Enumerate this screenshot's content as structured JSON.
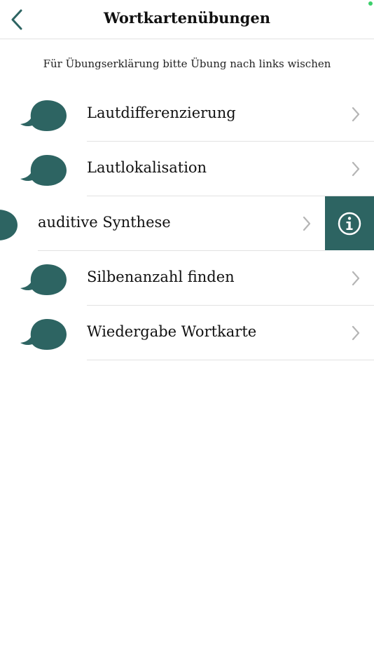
{
  "header": {
    "title": "Wortkartenübungen"
  },
  "hint": "Für Übungserklärung bitte Übung nach links wischen",
  "accent_color": "#2d6462",
  "exercises": [
    {
      "label": "Lautdifferenzierung",
      "icon": "speech-bubble-icon"
    },
    {
      "label": "Lautlokalisation",
      "icon": "speech-bubble-icon"
    },
    {
      "label": "auditive Synthese",
      "icon": "speech-bubble-icon",
      "swiped": true,
      "action_icon": "info-icon"
    },
    {
      "label": "Silbenanzahl finden",
      "icon": "speech-bubble-icon"
    },
    {
      "label": "Wiedergabe Wortkarte",
      "icon": "speech-bubble-icon"
    }
  ]
}
